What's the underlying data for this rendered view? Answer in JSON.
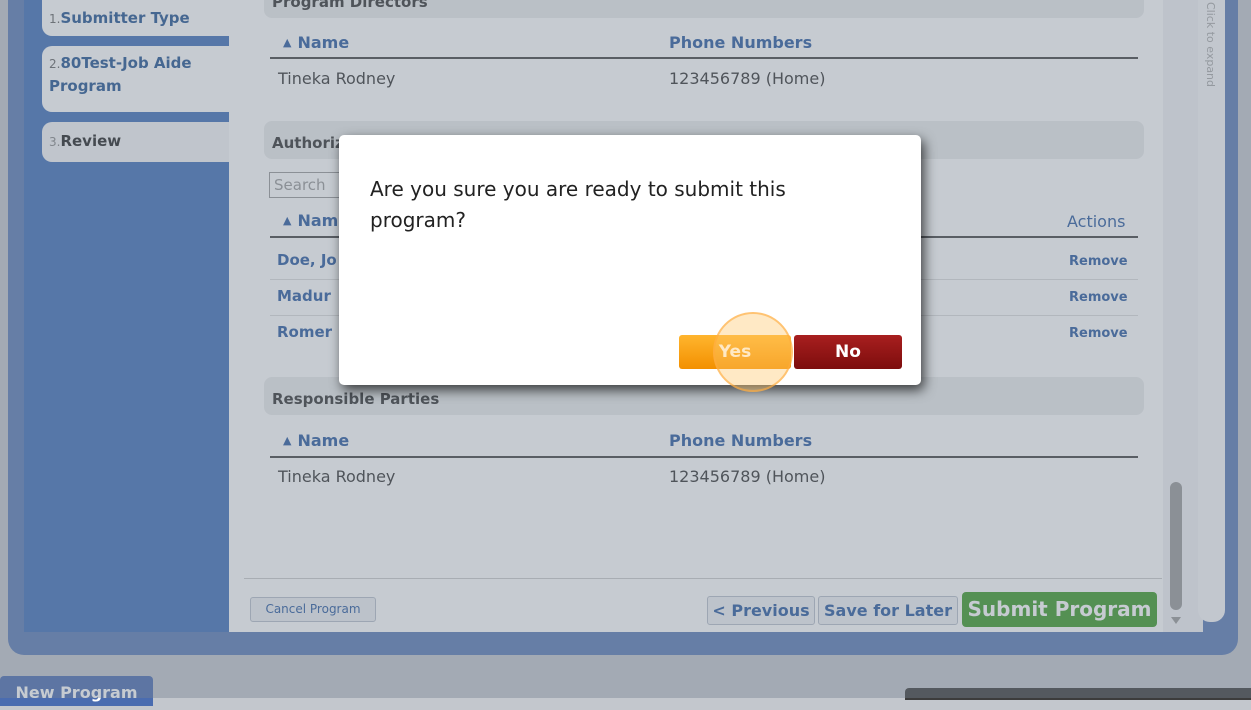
{
  "wizard_steps": [
    {
      "number": "1.",
      "label": "Submitter Type"
    },
    {
      "number": "2.",
      "label": "80Test-Job Aide Program"
    },
    {
      "number": "3.",
      "label": "Review"
    }
  ],
  "expand_panel": {
    "label": "Click to expand"
  },
  "program_directors": {
    "title": "Program Directors",
    "columns": [
      "Name",
      "Phone Numbers"
    ],
    "rows": [
      {
        "name": "Tineka Rodney",
        "phone": "123456789 (Home)"
      }
    ]
  },
  "authorized": {
    "title": "Authorized",
    "search_placeholder": "Search",
    "columns": {
      "name": "Name",
      "actions": "Actions"
    },
    "rows": [
      {
        "name": "Doe, Jo",
        "action": "Remove"
      },
      {
        "name": "Madur",
        "action": "Remove"
      },
      {
        "name": "Romer",
        "action": "Remove"
      }
    ]
  },
  "responsible_parties": {
    "title": "Responsible Parties",
    "columns": [
      "Name",
      "Phone Numbers"
    ],
    "rows": [
      {
        "name": "Tineka Rodney",
        "phone": "123456789 (Home)"
      }
    ]
  },
  "footer": {
    "cancel_label": "Cancel Program",
    "previous_label": "< Previous",
    "save_label": "Save for Later",
    "submit_label": "Submit Program"
  },
  "bottom_tab": {
    "label": "New Program"
  },
  "dialog": {
    "message": "Are you sure you are ready to submit this program?",
    "yes_label": "Yes",
    "no_label": "No"
  },
  "colors": {
    "accent_blue": "#2a5aa0",
    "submit_green": "#3b9a27",
    "yes_orange": "#f39000",
    "no_red": "#8b1414"
  }
}
